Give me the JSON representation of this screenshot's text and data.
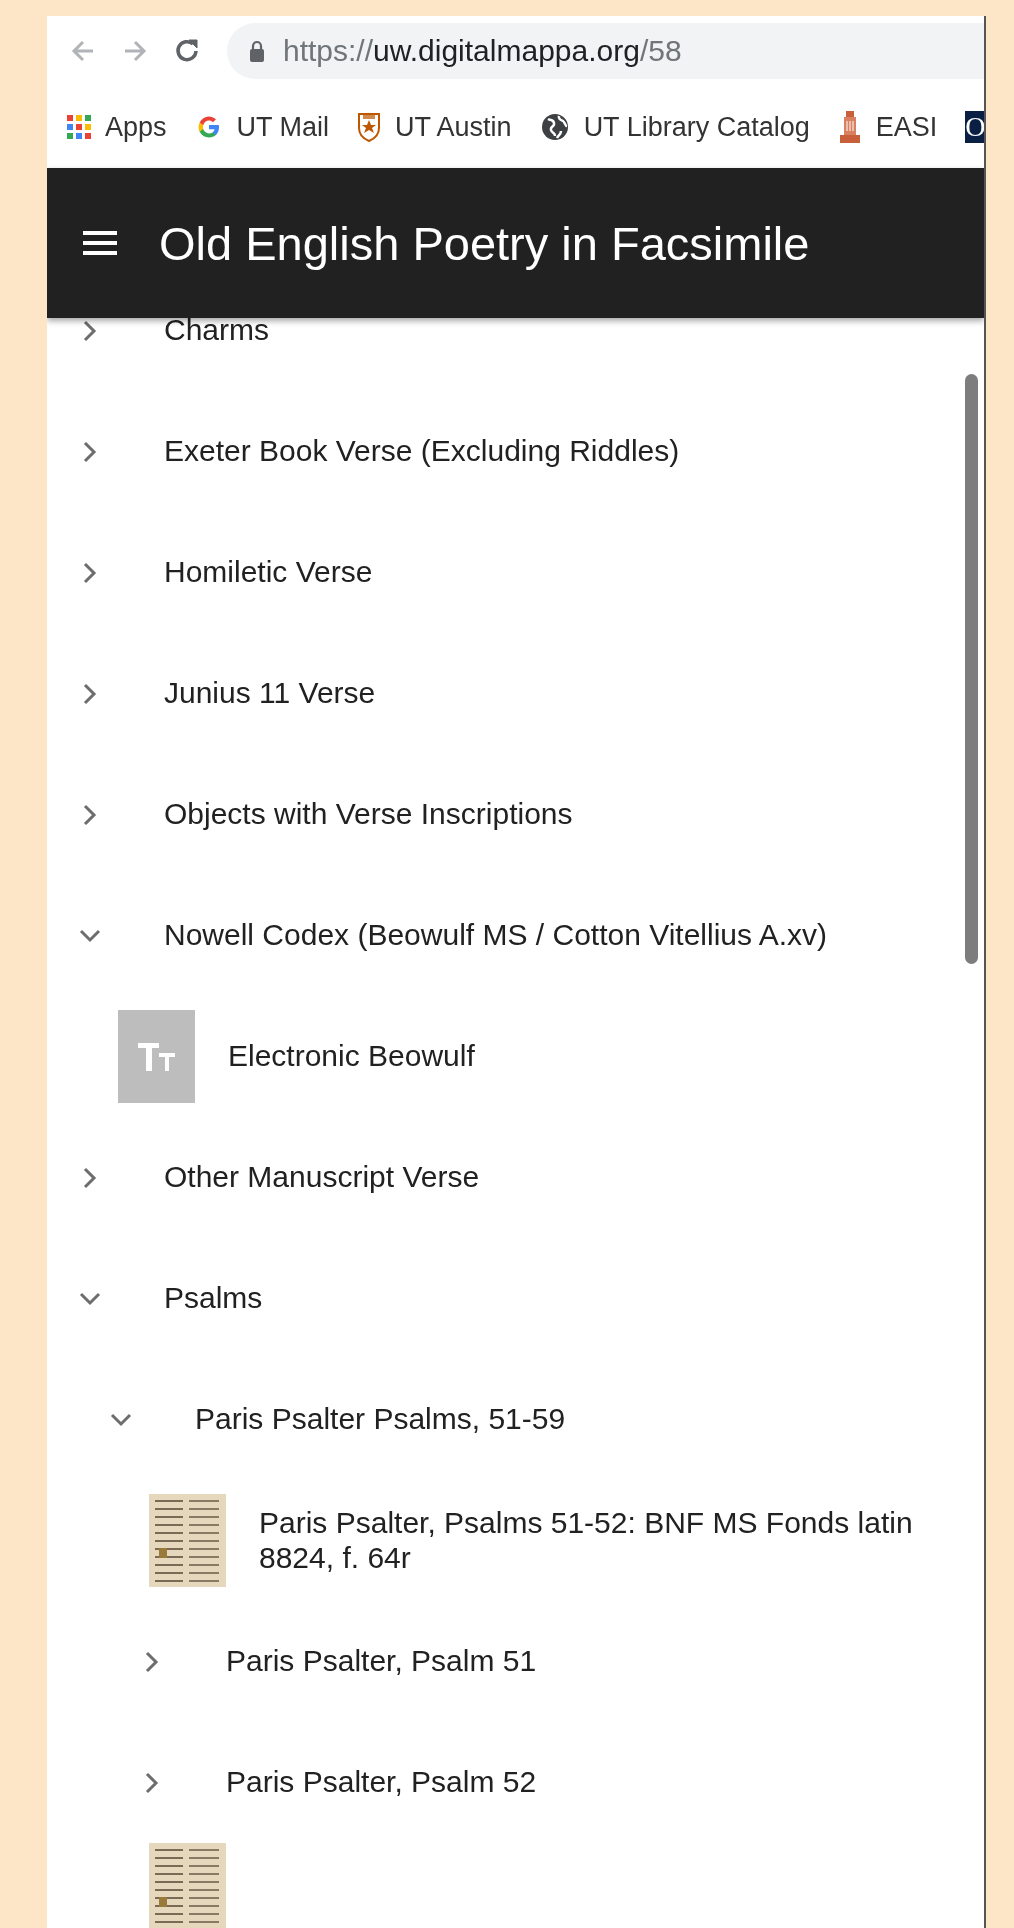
{
  "browser": {
    "nav_buttons": [
      {
        "kind": "back",
        "disabled": true
      },
      {
        "kind": "forward",
        "disabled": true
      },
      {
        "kind": "reload",
        "disabled": false
      }
    ],
    "address_bar": {
      "scheme": "https://",
      "host": "uw.digitalmappa.org",
      "path": "/58"
    },
    "bookmarks": [
      {
        "kind": "apps",
        "label": "Apps"
      },
      {
        "kind": "google",
        "label": "UT Mail"
      },
      {
        "kind": "shield",
        "label": "UT Austin"
      },
      {
        "kind": "globe",
        "label": "UT Library Catalog"
      },
      {
        "kind": "tower",
        "label": "EASI"
      },
      {
        "kind": "letter",
        "icon_text": "O"
      }
    ]
  },
  "header": {
    "title": "Old English Poetry in Facsimile"
  },
  "tree": [
    {
      "kind": "folder",
      "title": "Charms",
      "expanded": false
    },
    {
      "kind": "folder",
      "title": "Exeter Book Verse (Excluding Riddles)",
      "expanded": false
    },
    {
      "kind": "folder",
      "title": "Homiletic Verse",
      "expanded": false
    },
    {
      "kind": "folder",
      "title": "Junius 11 Verse",
      "expanded": false
    },
    {
      "kind": "folder",
      "title": "Objects with Verse Inscriptions",
      "expanded": false
    },
    {
      "kind": "folder",
      "title": "Nowell Codex (Beowulf MS / Cotton Vitellius A.xv)",
      "expanded": true,
      "children": [
        {
          "kind": "text-page",
          "title": "Electronic Beowulf"
        }
      ]
    },
    {
      "kind": "folder",
      "title": "Other Manuscript Verse",
      "expanded": false
    },
    {
      "kind": "folder",
      "title": "Psalms",
      "expanded": true,
      "children": [
        {
          "kind": "folder",
          "title": "Paris Psalter Psalms, 51-59",
          "expanded": true,
          "children": [
            {
              "kind": "manuscript-page",
              "title": "Paris Psalter, Psalms 51-52: BNF MS Fonds latin 8824, f. 64r"
            },
            {
              "kind": "folder",
              "title": "Paris Psalter, Psalm 51",
              "expanded": false
            },
            {
              "kind": "folder",
              "title": "Paris Psalter, Psalm 52",
              "expanded": false
            },
            {
              "kind": "manuscript-page"
            }
          ]
        }
      ]
    }
  ]
}
